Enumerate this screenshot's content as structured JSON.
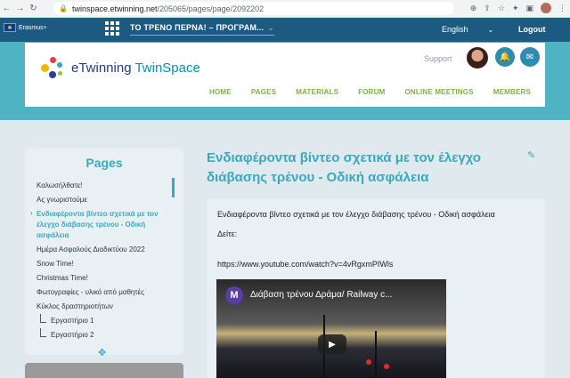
{
  "browser": {
    "url_host": "twinspace.etwinning.net",
    "url_path": "/205065/pages/page/2092202"
  },
  "topbar": {
    "program_label": "Erasmus+",
    "project_title": "ΤΟ ΤΡΕΝΟ ΠΕΡΝΑ! – ΠΡΟΓΡΑΜ...",
    "language": "English",
    "logout": "Logout"
  },
  "header": {
    "logo_text_e": "e",
    "logo_text_twinning": "Twinning",
    "logo_text_twinspace": " TwinSpace",
    "support": "Support",
    "menu": [
      "HOME",
      "PAGES",
      "MATERIALS",
      "FORUM",
      "ONLINE MEETINGS",
      "MEMBERS"
    ]
  },
  "sidebar": {
    "title": "Pages",
    "items": [
      "Καλωσήλθατε!",
      "Ας γνωριστούμε",
      "Ενδιαφέροντα βίντεο σχετικά με τον έλεγχο διάβασης τρένου - Οδική ασφάλεια",
      "Ημέρα Ασφαλούς Διαδικτύου 2022",
      "Snow Time!",
      "Christmas Time!",
      "Φωτογραφίες - υλικό από μαθητές",
      "Κύκλος δραστηριοτήτων"
    ],
    "subitems": [
      "Εργαστήριο 1",
      "Εργαστήριο 2"
    ]
  },
  "main": {
    "title": "Ενδιαφέροντα βίντεο σχετικά με τον έλεγχο διάβασης τρένου - Οδική ασφάλεια",
    "para1": "Ενδιαφέροντα βίντεο σχετικά με τον έλεγχο διάβασης τρένου - Οδική ασφάλεια",
    "para2": "Δείτε:",
    "link": "https://www.youtube.com/watch?v=4vRgxmPIWls",
    "video_channel_initial": "M",
    "video_title": "Διάβαση τρένου Δράμα/ Railway c..."
  }
}
